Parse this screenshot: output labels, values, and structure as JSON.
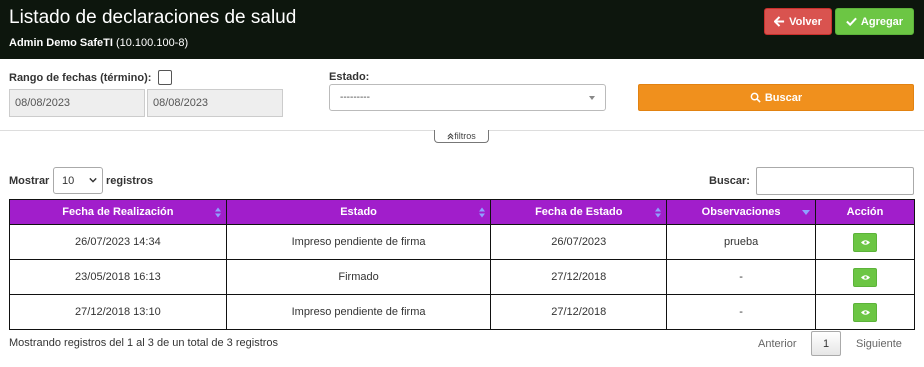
{
  "header": {
    "title": "Listado de declaraciones de salud",
    "user_name": "Admin Demo SafeTI",
    "user_rut": "(10.100.100-8)",
    "volver_label": "Volver",
    "agregar_label": "Agregar"
  },
  "filters": {
    "rango_label": "Rango de fechas (término):",
    "date_from": "08/08/2023",
    "date_to": "08/08/2023",
    "estado_label": "Estado:",
    "estado_value": "---------",
    "buscar_button": "Buscar",
    "toggle_label": "filtros"
  },
  "table_controls": {
    "mostrar_label": "Mostrar",
    "page_length": "10",
    "registros_label": "registros",
    "search_label": "Buscar:"
  },
  "table": {
    "columns": [
      "Fecha de Realización",
      "Estado",
      "Fecha de Estado",
      "Observaciones",
      "Acción"
    ],
    "rows": [
      {
        "fecha_realizacion": "26/07/2023 14:34",
        "estado": "Impreso pendiente de firma",
        "fecha_estado": "26/07/2023",
        "observaciones": "prueba"
      },
      {
        "fecha_realizacion": "23/05/2018 16:13",
        "estado": "Firmado",
        "fecha_estado": "27/12/2018",
        "observaciones": "-"
      },
      {
        "fecha_realizacion": "27/12/2018 13:10",
        "estado": "Impreso pendiente de firma",
        "fecha_estado": "27/12/2018",
        "observaciones": "-"
      }
    ]
  },
  "footer": {
    "info": "Mostrando registros del 1 al 3 de un total de 3 registros",
    "prev_label": "Anterior",
    "current_page": "1",
    "next_label": "Siguiente"
  },
  "colors": {
    "header_bg": "#0d160d",
    "volver": "#d9534f",
    "agregar": "#6cc644",
    "buscar": "#f0901d",
    "table_header": "#a11ecb"
  },
  "icons": {
    "volver": "arrow-left-icon",
    "agregar": "check-icon",
    "buscar": "search-icon",
    "filtros": "double-chevron-up-icon",
    "accion": "eye-icon"
  }
}
